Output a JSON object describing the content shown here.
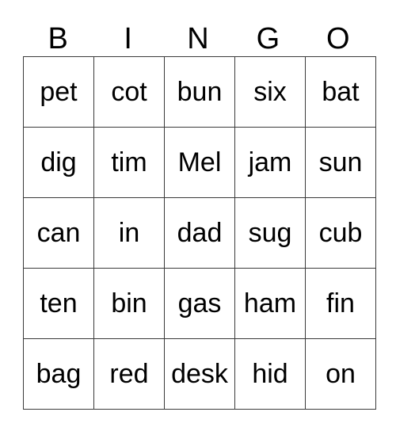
{
  "card": {
    "header_letters": [
      "B",
      "I",
      "N",
      "G",
      "O"
    ],
    "columns": 5,
    "rows": 5,
    "text_color": "#000000",
    "grid_line_color": "#3a3a3a",
    "background_color": "#ffffff",
    "cells": [
      [
        "pet",
        "cot",
        "bun",
        "six",
        "bat"
      ],
      [
        "dig",
        "tim",
        "Mel",
        "jam",
        "sun"
      ],
      [
        "can",
        "in",
        "dad",
        "sug",
        "cub"
      ],
      [
        "ten",
        "bin",
        "gas",
        "ham",
        "fin"
      ],
      [
        "bag",
        "red",
        "desk",
        "hid",
        "on"
      ]
    ]
  }
}
